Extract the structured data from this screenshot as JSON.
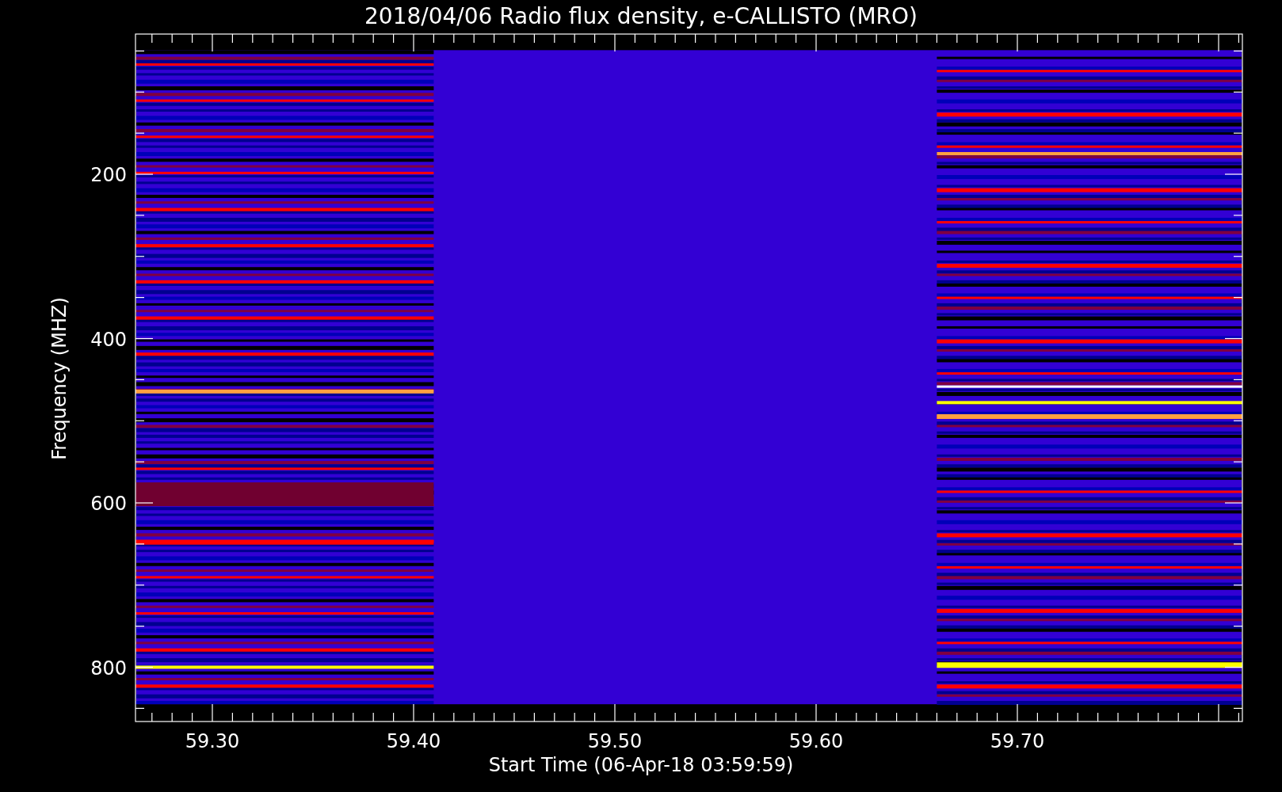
{
  "title": "2018/04/06  Radio flux density, e-CALLISTO (MRO)",
  "y_axis": {
    "label": "Frequency (MHZ)",
    "ticks": [
      "200",
      "400",
      "600",
      "800"
    ]
  },
  "x_axis": {
    "label": "Start Time (06-Apr-18 03:59:59)",
    "ticks": [
      "59.30",
      "59.40",
      "59.50",
      "59.60",
      "59.70"
    ]
  }
}
